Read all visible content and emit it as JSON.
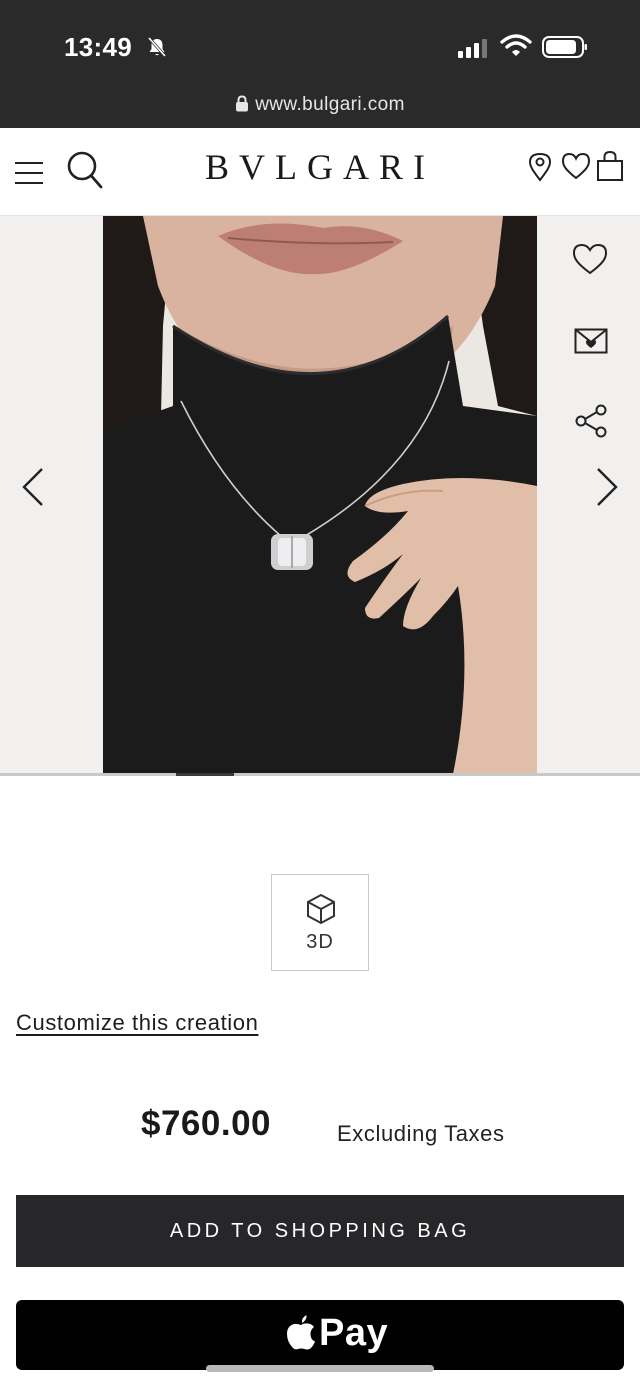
{
  "status_bar": {
    "time": "13:49",
    "icons": [
      "bell-muted-icon",
      "signal-icon",
      "wifi-icon",
      "battery-icon"
    ]
  },
  "browser": {
    "url": "www.bulgari.com",
    "icon": "lock-icon"
  },
  "header": {
    "brand": "BVLGARI",
    "icons": [
      "hamburger-icon",
      "search-icon",
      "location-icon",
      "heart-icon",
      "shopping-bag-icon"
    ]
  },
  "gallery": {
    "image_description_icon": "product-photo",
    "actions": [
      "heart-icon",
      "mail-icon",
      "share-icon"
    ],
    "nav": [
      "chevron-left-icon",
      "chevron-right-icon"
    ],
    "progress_fraction": 0.09
  },
  "viewer": {
    "label": "3D",
    "icon": "cube-icon"
  },
  "customize": {
    "label": "Customize this creation"
  },
  "price": {
    "amount": "$760.00",
    "note": "Excluding Taxes"
  },
  "buttons": {
    "add_to_bag": "ADD TO SHOPPING BAG",
    "apple_pay": "Pay"
  },
  "colors": {
    "status_bg": "#2a2a2a",
    "button_dark": "#27272a",
    "apple_pay_bg": "#000000"
  }
}
